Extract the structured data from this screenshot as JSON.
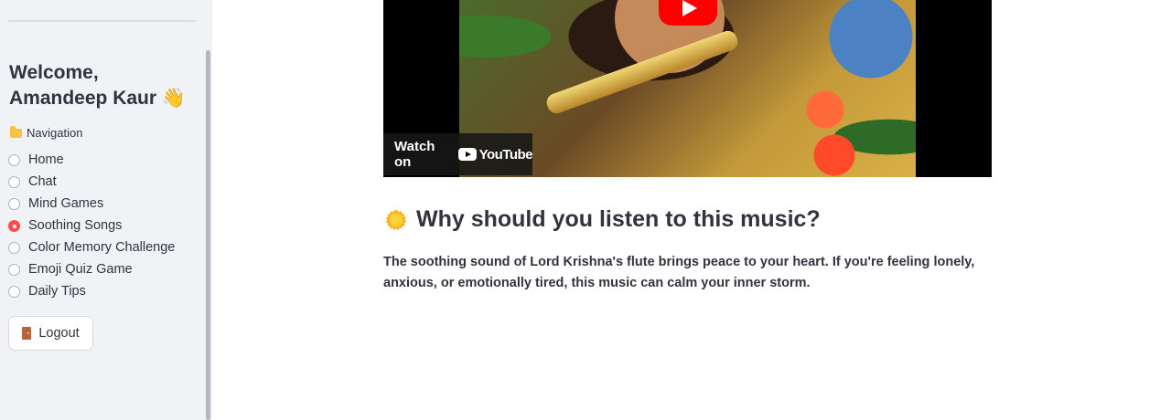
{
  "sidebar": {
    "welcome": "Welcome, Amandeep Kaur 👋",
    "nav_heading": "Navigation",
    "items": [
      {
        "label": "Home",
        "selected": false
      },
      {
        "label": "Chat",
        "selected": false
      },
      {
        "label": "Mind Games",
        "selected": false
      },
      {
        "label": "Soothing Songs",
        "selected": true
      },
      {
        "label": "Color Memory Challenge",
        "selected": false
      },
      {
        "label": "Emoji Quiz Game",
        "selected": false
      },
      {
        "label": "Daily Tips",
        "selected": false
      }
    ],
    "logout_label": "Logout"
  },
  "video": {
    "watch_on": "Watch on",
    "brand": "YouTube"
  },
  "main": {
    "heading": "Why should you listen to this music?",
    "paragraph": "The soothing sound of Lord Krishna's flute brings peace to your heart. If you're feeling lonely, anxious, or emotionally tired, this music can calm your inner storm."
  },
  "colors": {
    "accent": "#ff4b4b",
    "sidebar_bg": "#f0f2f6",
    "text": "#31333f"
  }
}
